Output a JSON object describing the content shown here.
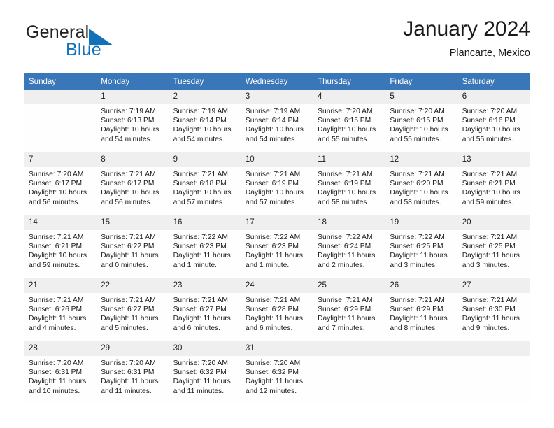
{
  "brand": {
    "name_top": "General",
    "name_bottom": "Blue",
    "flag_icon": "blue-triangle-flag-icon",
    "colors": {
      "text": "#231f20",
      "accent": "#1271b8"
    }
  },
  "header": {
    "title": "January 2024",
    "subtitle": "Plancarte, Mexico"
  },
  "theme": {
    "header_row_bg": "#3a77b8",
    "daynum_bg": "#efefef",
    "week_divider": "#3a77b8"
  },
  "calendar": {
    "weekdays": [
      "Sunday",
      "Monday",
      "Tuesday",
      "Wednesday",
      "Thursday",
      "Friday",
      "Saturday"
    ],
    "weeks": [
      [
        {
          "day": "",
          "sunrise": "",
          "sunset": "",
          "daylight1": "",
          "daylight2": ""
        },
        {
          "day": "1",
          "sunrise": "Sunrise: 7:19 AM",
          "sunset": "Sunset: 6:13 PM",
          "daylight1": "Daylight: 10 hours",
          "daylight2": "and 54 minutes."
        },
        {
          "day": "2",
          "sunrise": "Sunrise: 7:19 AM",
          "sunset": "Sunset: 6:14 PM",
          "daylight1": "Daylight: 10 hours",
          "daylight2": "and 54 minutes."
        },
        {
          "day": "3",
          "sunrise": "Sunrise: 7:19 AM",
          "sunset": "Sunset: 6:14 PM",
          "daylight1": "Daylight: 10 hours",
          "daylight2": "and 54 minutes."
        },
        {
          "day": "4",
          "sunrise": "Sunrise: 7:20 AM",
          "sunset": "Sunset: 6:15 PM",
          "daylight1": "Daylight: 10 hours",
          "daylight2": "and 55 minutes."
        },
        {
          "day": "5",
          "sunrise": "Sunrise: 7:20 AM",
          "sunset": "Sunset: 6:15 PM",
          "daylight1": "Daylight: 10 hours",
          "daylight2": "and 55 minutes."
        },
        {
          "day": "6",
          "sunrise": "Sunrise: 7:20 AM",
          "sunset": "Sunset: 6:16 PM",
          "daylight1": "Daylight: 10 hours",
          "daylight2": "and 55 minutes."
        }
      ],
      [
        {
          "day": "7",
          "sunrise": "Sunrise: 7:20 AM",
          "sunset": "Sunset: 6:17 PM",
          "daylight1": "Daylight: 10 hours",
          "daylight2": "and 56 minutes."
        },
        {
          "day": "8",
          "sunrise": "Sunrise: 7:21 AM",
          "sunset": "Sunset: 6:17 PM",
          "daylight1": "Daylight: 10 hours",
          "daylight2": "and 56 minutes."
        },
        {
          "day": "9",
          "sunrise": "Sunrise: 7:21 AM",
          "sunset": "Sunset: 6:18 PM",
          "daylight1": "Daylight: 10 hours",
          "daylight2": "and 57 minutes."
        },
        {
          "day": "10",
          "sunrise": "Sunrise: 7:21 AM",
          "sunset": "Sunset: 6:19 PM",
          "daylight1": "Daylight: 10 hours",
          "daylight2": "and 57 minutes."
        },
        {
          "day": "11",
          "sunrise": "Sunrise: 7:21 AM",
          "sunset": "Sunset: 6:19 PM",
          "daylight1": "Daylight: 10 hours",
          "daylight2": "and 58 minutes."
        },
        {
          "day": "12",
          "sunrise": "Sunrise: 7:21 AM",
          "sunset": "Sunset: 6:20 PM",
          "daylight1": "Daylight: 10 hours",
          "daylight2": "and 58 minutes."
        },
        {
          "day": "13",
          "sunrise": "Sunrise: 7:21 AM",
          "sunset": "Sunset: 6:21 PM",
          "daylight1": "Daylight: 10 hours",
          "daylight2": "and 59 minutes."
        }
      ],
      [
        {
          "day": "14",
          "sunrise": "Sunrise: 7:21 AM",
          "sunset": "Sunset: 6:21 PM",
          "daylight1": "Daylight: 10 hours",
          "daylight2": "and 59 minutes."
        },
        {
          "day": "15",
          "sunrise": "Sunrise: 7:21 AM",
          "sunset": "Sunset: 6:22 PM",
          "daylight1": "Daylight: 11 hours",
          "daylight2": "and 0 minutes."
        },
        {
          "day": "16",
          "sunrise": "Sunrise: 7:22 AM",
          "sunset": "Sunset: 6:23 PM",
          "daylight1": "Daylight: 11 hours",
          "daylight2": "and 1 minute."
        },
        {
          "day": "17",
          "sunrise": "Sunrise: 7:22 AM",
          "sunset": "Sunset: 6:23 PM",
          "daylight1": "Daylight: 11 hours",
          "daylight2": "and 1 minute."
        },
        {
          "day": "18",
          "sunrise": "Sunrise: 7:22 AM",
          "sunset": "Sunset: 6:24 PM",
          "daylight1": "Daylight: 11 hours",
          "daylight2": "and 2 minutes."
        },
        {
          "day": "19",
          "sunrise": "Sunrise: 7:22 AM",
          "sunset": "Sunset: 6:25 PM",
          "daylight1": "Daylight: 11 hours",
          "daylight2": "and 3 minutes."
        },
        {
          "day": "20",
          "sunrise": "Sunrise: 7:21 AM",
          "sunset": "Sunset: 6:25 PM",
          "daylight1": "Daylight: 11 hours",
          "daylight2": "and 3 minutes."
        }
      ],
      [
        {
          "day": "21",
          "sunrise": "Sunrise: 7:21 AM",
          "sunset": "Sunset: 6:26 PM",
          "daylight1": "Daylight: 11 hours",
          "daylight2": "and 4 minutes."
        },
        {
          "day": "22",
          "sunrise": "Sunrise: 7:21 AM",
          "sunset": "Sunset: 6:27 PM",
          "daylight1": "Daylight: 11 hours",
          "daylight2": "and 5 minutes."
        },
        {
          "day": "23",
          "sunrise": "Sunrise: 7:21 AM",
          "sunset": "Sunset: 6:27 PM",
          "daylight1": "Daylight: 11 hours",
          "daylight2": "and 6 minutes."
        },
        {
          "day": "24",
          "sunrise": "Sunrise: 7:21 AM",
          "sunset": "Sunset: 6:28 PM",
          "daylight1": "Daylight: 11 hours",
          "daylight2": "and 6 minutes."
        },
        {
          "day": "25",
          "sunrise": "Sunrise: 7:21 AM",
          "sunset": "Sunset: 6:29 PM",
          "daylight1": "Daylight: 11 hours",
          "daylight2": "and 7 minutes."
        },
        {
          "day": "26",
          "sunrise": "Sunrise: 7:21 AM",
          "sunset": "Sunset: 6:29 PM",
          "daylight1": "Daylight: 11 hours",
          "daylight2": "and 8 minutes."
        },
        {
          "day": "27",
          "sunrise": "Sunrise: 7:21 AM",
          "sunset": "Sunset: 6:30 PM",
          "daylight1": "Daylight: 11 hours",
          "daylight2": "and 9 minutes."
        }
      ],
      [
        {
          "day": "28",
          "sunrise": "Sunrise: 7:20 AM",
          "sunset": "Sunset: 6:31 PM",
          "daylight1": "Daylight: 11 hours",
          "daylight2": "and 10 minutes."
        },
        {
          "day": "29",
          "sunrise": "Sunrise: 7:20 AM",
          "sunset": "Sunset: 6:31 PM",
          "daylight1": "Daylight: 11 hours",
          "daylight2": "and 11 minutes."
        },
        {
          "day": "30",
          "sunrise": "Sunrise: 7:20 AM",
          "sunset": "Sunset: 6:32 PM",
          "daylight1": "Daylight: 11 hours",
          "daylight2": "and 11 minutes."
        },
        {
          "day": "31",
          "sunrise": "Sunrise: 7:20 AM",
          "sunset": "Sunset: 6:32 PM",
          "daylight1": "Daylight: 11 hours",
          "daylight2": "and 12 minutes."
        },
        {
          "day": "",
          "sunrise": "",
          "sunset": "",
          "daylight1": "",
          "daylight2": ""
        },
        {
          "day": "",
          "sunrise": "",
          "sunset": "",
          "daylight1": "",
          "daylight2": ""
        },
        {
          "day": "",
          "sunrise": "",
          "sunset": "",
          "daylight1": "",
          "daylight2": ""
        }
      ]
    ]
  }
}
